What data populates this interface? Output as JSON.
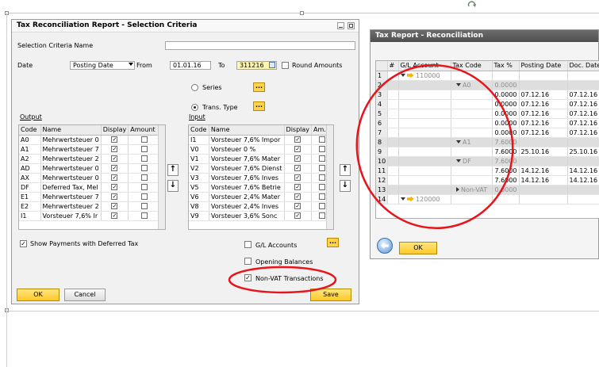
{
  "left_dialog": {
    "title": "Tax Reconciliation Report - Selection Criteria",
    "selection_criteria_name_label": "Selection Criteria Name",
    "selection_criteria_name_value": "",
    "date_label": "Date",
    "date_type_value": "Posting Date",
    "from_label": "From",
    "from_value": "01.01.16",
    "to_label": "To",
    "to_value": "311216",
    "round_amounts_label": "Round Amounts",
    "round_amounts_checked": false,
    "series_label": "Series",
    "trans_type_label": "Trans. Type",
    "selected_radio": "Trans. Type",
    "dots": "...",
    "output_label": "Output",
    "input_label": "Input",
    "output_grid": {
      "headers": [
        "Code",
        "Name",
        "Display",
        "Amount"
      ],
      "rows": [
        {
          "code": "A0",
          "name": "Mehrwertsteuer 0",
          "display": true,
          "amount": false
        },
        {
          "code": "A1",
          "name": "Mehrwertsteuer 7",
          "display": true,
          "amount": false
        },
        {
          "code": "A2",
          "name": "Mehrwertsteuer 2",
          "display": true,
          "amount": false
        },
        {
          "code": "AD",
          "name": "Mehrwertsteuer 0",
          "display": true,
          "amount": false
        },
        {
          "code": "AX",
          "name": "Mehrwertsteuer 0",
          "display": true,
          "amount": false
        },
        {
          "code": "DF",
          "name": "Deferred Tax, Mel",
          "display": true,
          "amount": false
        },
        {
          "code": "E1",
          "name": "Mehrwertsteuer 7",
          "display": true,
          "amount": false
        },
        {
          "code": "E2",
          "name": "Mehrwertsteuer 2",
          "display": true,
          "amount": false
        },
        {
          "code": "I1",
          "name": "Vorsteuer 7,6% Ir",
          "display": true,
          "amount": false
        }
      ]
    },
    "input_grid": {
      "headers": [
        "Code",
        "Name",
        "Display",
        "Am..."
      ],
      "rows": [
        {
          "code": "I1",
          "name": "Vorsteuer 7,6% Impor",
          "display": true,
          "amount": false
        },
        {
          "code": "V0",
          "name": "Vorsteuer 0 %",
          "display": true,
          "amount": false
        },
        {
          "code": "V1",
          "name": "Vorsteuer 7,6% Mater",
          "display": true,
          "amount": false
        },
        {
          "code": "V2",
          "name": "Vorsteuer 7,6% Dienst",
          "display": true,
          "amount": false
        },
        {
          "code": "V3",
          "name": "Vorsteuer 7,6% Inves",
          "display": true,
          "amount": false
        },
        {
          "code": "V5",
          "name": "Vorsteuer 7,6% Betrie",
          "display": true,
          "amount": false
        },
        {
          "code": "V6",
          "name": "Vorsteuer 2,4% Mater",
          "display": true,
          "amount": false
        },
        {
          "code": "V8",
          "name": "Vorsteuer 2,4% Inves",
          "display": true,
          "amount": false
        },
        {
          "code": "V9",
          "name": "Vorsteuer 3,6%  Sonc",
          "display": true,
          "amount": false
        }
      ]
    },
    "show_deferred_label": "Show Payments with Deferred Tax",
    "show_deferred_checked": true,
    "gl_accounts_label": "G/L Accounts",
    "gl_accounts_checked": false,
    "opening_balances_label": "Opening Balances",
    "opening_balances_checked": false,
    "non_vat_label": "Non-VAT Transactions",
    "non_vat_checked": true,
    "ok_label": "OK",
    "cancel_label": "Cancel",
    "save_label": "Save",
    "up_arrow": "↑",
    "down_arrow": "↓",
    "check_mark": "✓"
  },
  "right_window": {
    "title": "Tax Report - Reconciliation",
    "headers": [
      "",
      "#",
      "G/L Account",
      "Tax Code",
      "Tax %",
      "Posting Date",
      "Doc. Date"
    ],
    "rows": [
      {
        "n": "1",
        "type": "account",
        "gl": "110000",
        "code": "",
        "pct": "",
        "post": "",
        "doc": ""
      },
      {
        "n": "2",
        "type": "group",
        "gl": "",
        "code": "A0",
        "pct": "0.0000",
        "post": "",
        "doc": ""
      },
      {
        "n": "3",
        "type": "line",
        "gl": "",
        "code": "",
        "pct": "0.0000",
        "post": "07.12.16",
        "doc": "07.12.16"
      },
      {
        "n": "4",
        "type": "line",
        "gl": "",
        "code": "",
        "pct": "0.0000",
        "post": "07.12.16",
        "doc": "07.12.16"
      },
      {
        "n": "5",
        "type": "line",
        "gl": "",
        "code": "",
        "pct": "0.0000",
        "post": "07.12.16",
        "doc": "07.12.16"
      },
      {
        "n": "6",
        "type": "line",
        "gl": "",
        "code": "",
        "pct": "0.0000",
        "post": "07.12.16",
        "doc": "07.12.16"
      },
      {
        "n": "7",
        "type": "line",
        "gl": "",
        "code": "",
        "pct": "0.0000",
        "post": "07.12.16",
        "doc": "07.12.16"
      },
      {
        "n": "8",
        "type": "group",
        "gl": "",
        "code": "A1",
        "pct": "7.6000",
        "post": "",
        "doc": ""
      },
      {
        "n": "9",
        "type": "line",
        "gl": "",
        "code": "",
        "pct": "7.6000",
        "post": "25.10.16",
        "doc": "25.10.16"
      },
      {
        "n": "10",
        "type": "group",
        "gl": "",
        "code": "DF",
        "pct": "7.6000",
        "post": "",
        "doc": ""
      },
      {
        "n": "11",
        "type": "line",
        "gl": "",
        "code": "",
        "pct": "7.6000",
        "post": "14.12.16",
        "doc": "14.12.16"
      },
      {
        "n": "12",
        "type": "line",
        "gl": "",
        "code": "",
        "pct": "7.6000",
        "post": "14.12.16",
        "doc": "14.12.16"
      },
      {
        "n": "13",
        "type": "collapsed",
        "gl": "",
        "code": "Non-VAT",
        "pct": "0.0000",
        "post": "",
        "doc": ""
      },
      {
        "n": "14",
        "type": "account2",
        "gl": "120000",
        "code": "",
        "pct": "",
        "post": "",
        "doc": ""
      }
    ],
    "ok_label": "OK"
  },
  "colors": {
    "annotation_red": "#e8141c",
    "button_yellow": "#ffc928"
  }
}
